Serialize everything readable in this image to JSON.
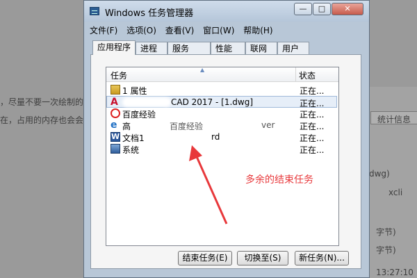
{
  "background": {
    "line1_prefix": "，尽量不要一次绘制的",
    "line2_prefix": "在，占用的内存也会会",
    "right_fragments": [
      "er",
      "统计信息",
      "dwg)",
      "xcli",
      "字节)",
      "字节)",
      "13:27:10"
    ]
  },
  "window": {
    "title": "Windows 任务管理器",
    "controls": {
      "minimize": "—",
      "maximize": "□",
      "close": "✕"
    }
  },
  "menu": [
    "文件(F)",
    "选项(O)",
    "查看(V)",
    "窗口(W)",
    "帮助(H)"
  ],
  "tabs": [
    "应用程序",
    "进程",
    "服务",
    "性能",
    "联网",
    "用户"
  ],
  "active_tab": "应用程序",
  "list": {
    "columns": {
      "task": "任务",
      "status": "状态"
    },
    "rows": [
      {
        "icon": "folder-icon",
        "name": "1 属性",
        "status": "正在...",
        "selected": false
      },
      {
        "icon": "autocad-icon",
        "name": "CAD 2017 - [1.dwg]",
        "status": "正在...",
        "selected": true
      },
      {
        "icon": "baidu-icon",
        "name": "百度经验",
        "status": "正在...",
        "selected": false
      },
      {
        "icon": "ie-icon",
        "name": "高",
        "status": "正在...",
        "selected": false
      },
      {
        "icon": "word-icon",
        "name": "文档1",
        "status": "正在...",
        "selected": false
      },
      {
        "icon": "system-icon",
        "name": "系统",
        "status": "正在...",
        "selected": false
      }
    ],
    "row_fragments": {
      "ie_suffix": "ver",
      "word_suffix": "rd",
      "ie_mid": "百度经验"
    }
  },
  "buttons": {
    "end_task": "结束任务(E)",
    "switch_to": "切换至(S)",
    "new_task": "新任务(N)..."
  },
  "annotation": {
    "text": "多余的结束任务",
    "color": "#e8383b"
  }
}
